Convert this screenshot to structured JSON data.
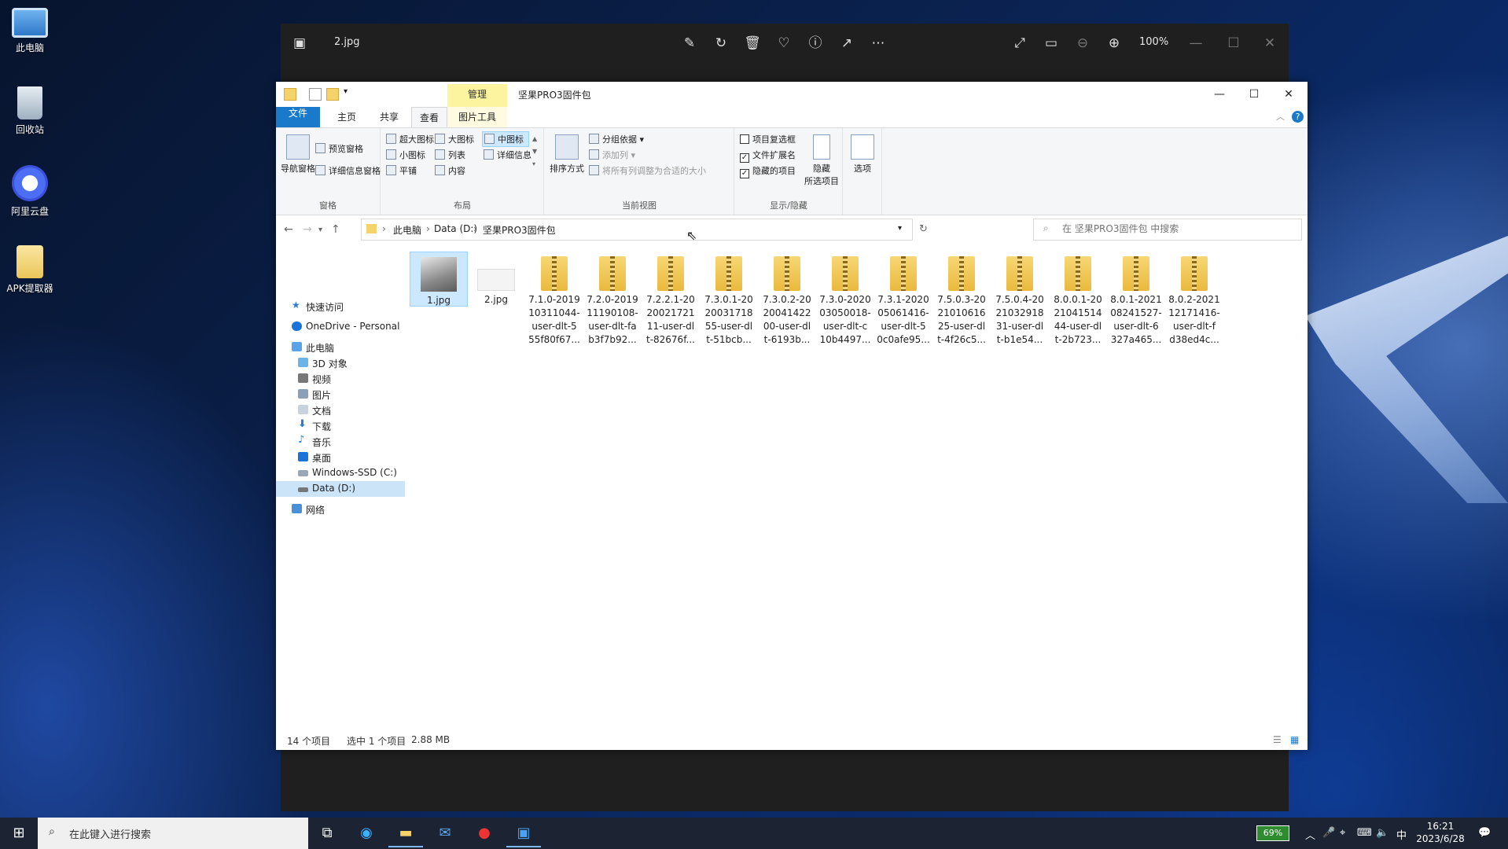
{
  "desktop": {
    "icons": [
      {
        "label": "此电脑"
      },
      {
        "label": "回收站"
      },
      {
        "label": "阿里云盘"
      },
      {
        "label": "APK提取器"
      }
    ]
  },
  "viewer": {
    "filename": "2.jpg",
    "zoom": "100%"
  },
  "explorer": {
    "context_tab": "管理",
    "title": "坚果PRO3固件包",
    "tabs": {
      "file": "文件",
      "home": "主页",
      "share": "共享",
      "view": "查看",
      "picture_tools": "图片工具"
    },
    "ribbon": {
      "panes": {
        "nav_pane": "导航窗格",
        "preview": "预览窗格",
        "details": "详细信息窗格",
        "group": "窗格"
      },
      "layout": {
        "xl": "超大图标",
        "large": "大图标",
        "medium": "中图标",
        "small": "小图标",
        "list": "列表",
        "details": "详细信息",
        "tiles": "平铺",
        "content": "内容",
        "group": "布局"
      },
      "current_view": {
        "sort": "排序方式",
        "group_by": "分组依据",
        "add_col": "添加列",
        "fit_cols": "将所有列调整为合适的大小",
        "group": "当前视图"
      },
      "show_hide": {
        "item_check": "项目复选框",
        "extensions": "文件扩展名",
        "hidden": "隐藏的项目",
        "hide_sel_1": "隐藏",
        "hide_sel_2": "所选项目",
        "group": "显示/隐藏"
      },
      "options": "选项"
    },
    "address": {
      "crumbs": [
        "此电脑",
        "Data (D:)",
        "坚果PRO3固件包"
      ]
    },
    "search": {
      "placeholder": "在 坚果PRO3固件包 中搜索"
    },
    "nav": [
      {
        "label": "快速访问"
      },
      {
        "label": "OneDrive - Personal"
      },
      {
        "label": "此电脑"
      },
      {
        "label": "3D 对象"
      },
      {
        "label": "视频"
      },
      {
        "label": "图片"
      },
      {
        "label": "文档"
      },
      {
        "label": "下载"
      },
      {
        "label": "音乐"
      },
      {
        "label": "桌面"
      },
      {
        "label": "Windows-SSD (C:)"
      },
      {
        "label": "Data (D:)"
      },
      {
        "label": "网络"
      }
    ],
    "files": [
      {
        "name": "1.jpg"
      },
      {
        "name": "2.jpg"
      },
      {
        "l1": "7.1.0-2019",
        "l2": "10311044-",
        "l3": "user-dlt-5",
        "l4": "55f80f67..."
      },
      {
        "l1": "7.2.0-2019",
        "l2": "11190108-",
        "l3": "user-dlt-fa",
        "l4": "b3f7b92..."
      },
      {
        "l1": "7.2.2.1-20",
        "l2": "20021721",
        "l3": "11-user-dl",
        "l4": "t-82676f..."
      },
      {
        "l1": "7.3.0.1-20",
        "l2": "20031718",
        "l3": "55-user-dl",
        "l4": "t-51bcb..."
      },
      {
        "l1": "7.3.0.2-20",
        "l2": "20041422",
        "l3": "00-user-dl",
        "l4": "t-6193b..."
      },
      {
        "l1": "7.3.0-2020",
        "l2": "03050018-",
        "l3": "user-dlt-c",
        "l4": "10b4497..."
      },
      {
        "l1": "7.3.1-2020",
        "l2": "05061416-",
        "l3": "user-dlt-5",
        "l4": "0c0afe95..."
      },
      {
        "l1": "7.5.0.3-20",
        "l2": "21010616",
        "l3": "25-user-dl",
        "l4": "t-4f26c5..."
      },
      {
        "l1": "7.5.0.4-20",
        "l2": "21032918",
        "l3": "31-user-dl",
        "l4": "t-b1e54..."
      },
      {
        "l1": "8.0.0.1-20",
        "l2": "21041514",
        "l3": "44-user-dl",
        "l4": "t-2b723..."
      },
      {
        "l1": "8.0.1-2021",
        "l2": "08241527-",
        "l3": "user-dlt-6",
        "l4": "327a465..."
      },
      {
        "l1": "8.0.2-2021",
        "l2": "12171416-",
        "l3": "user-dlt-f",
        "l4": "d38ed4c..."
      }
    ],
    "status": {
      "count": "14 个项目",
      "selected": "选中 1 个项目",
      "size": "2.88 MB"
    }
  },
  "taskbar": {
    "search_placeholder": "在此键入进行搜索",
    "battery": "69%",
    "ime": "中",
    "time": "16:21",
    "date": "2023/6/28"
  }
}
